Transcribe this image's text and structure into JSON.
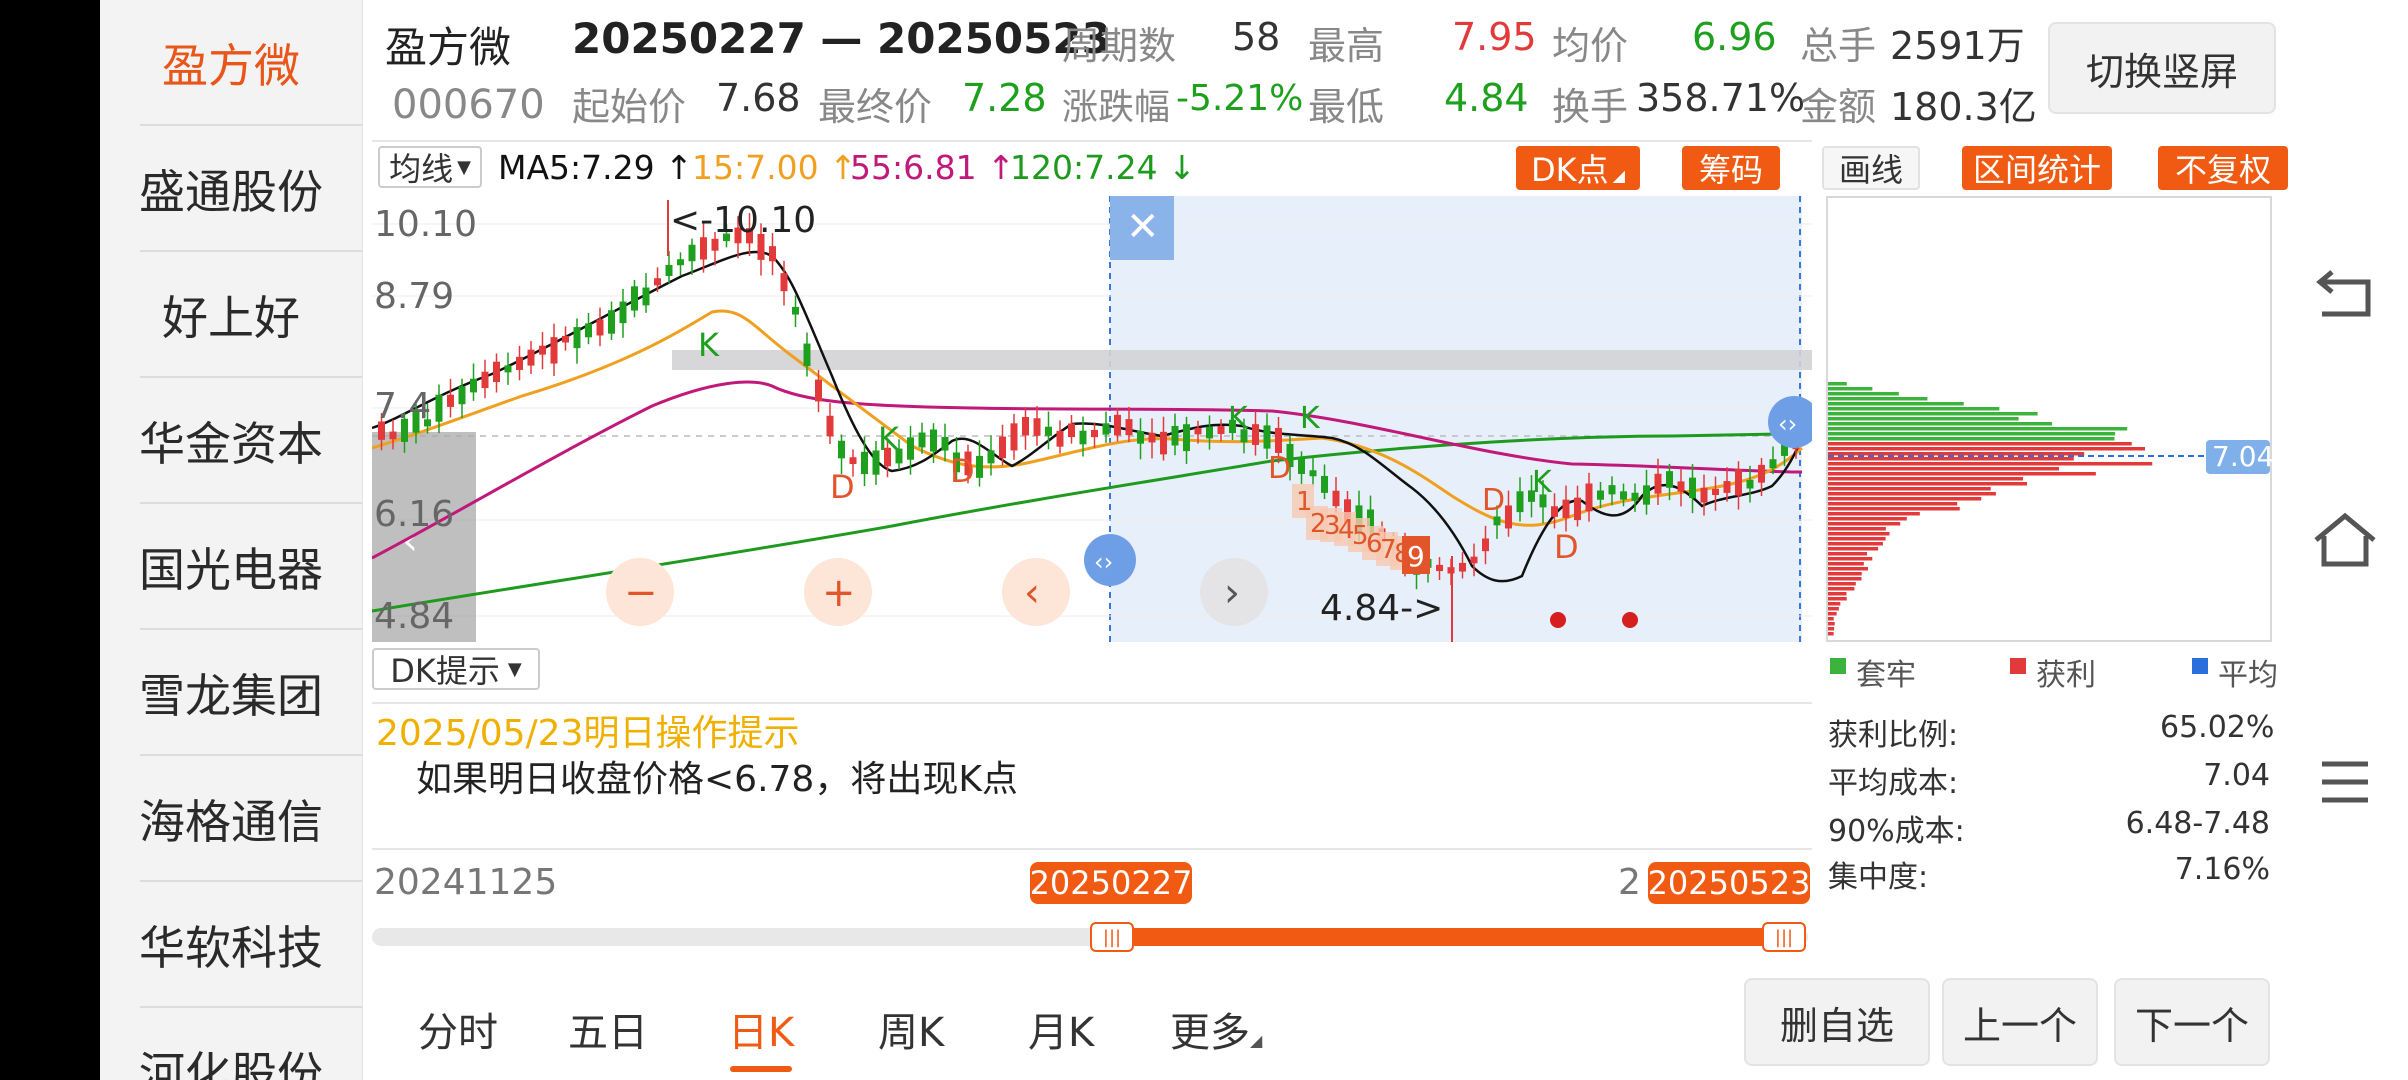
{
  "sidebar": {
    "items": [
      "盈方微",
      "盛通股份",
      "好上好",
      "华金资本",
      "国光电器",
      "雪龙集团",
      "海格通信",
      "华软科技",
      "河化股份"
    ]
  },
  "header": {
    "name": "盈方微",
    "code": "000670",
    "date_range": "20250227 — 20250523",
    "period_label": "周期数",
    "period_value": "58",
    "high_label": "最高",
    "high_value": "7.95",
    "avg_label": "均价",
    "avg_value": "6.96",
    "vol_label": "总手",
    "vol_value": "2591万",
    "start_label": "起始价",
    "start_value": "7.68",
    "end_label": "最终价",
    "end_value": "7.28",
    "chg_label": "涨跌幅",
    "chg_value": "-5.21%",
    "low_label": "最低",
    "low_value": "4.84",
    "turnover_label": "换手",
    "turnover_value": "358.71%",
    "amount_label": "金额",
    "amount_value": "180.3亿",
    "switch_button": "切换竖屏"
  },
  "indicator_bar": {
    "selector": "均线",
    "ma5": "MA5:7.29 ↑",
    "ma15": "15:7.00 ↑",
    "ma55": "55:6.81 ↑",
    "ma120": "120:7.24 ↓",
    "dk_button": "DK点",
    "chip_button": "筹码",
    "draw_button": "画线",
    "range_button": "区间统计",
    "adjust_button": "不复权"
  },
  "chart": {
    "y_labels": [
      "10.10",
      "8.79",
      "7.4",
      "6.16",
      "4.84"
    ],
    "max_marker": "<-10.10",
    "min_marker": "4.84->",
    "signals": [
      "K",
      "D",
      "K",
      "D",
      "K",
      "K",
      "D",
      "D",
      "K",
      "D"
    ],
    "seq_numbers": [
      "1",
      "2",
      "3",
      "4",
      "5",
      "6",
      "7",
      "8",
      "9"
    ],
    "colors": {
      "up": "#e23a3a",
      "down": "#1ea01e",
      "ma5": "#111111",
      "ma15": "#f0a020",
      "ma55": "#c0197a",
      "ma120": "#1e9a1e",
      "selection": "#e7effa",
      "accent": "#f15a12"
    }
  },
  "chip": {
    "price_tag": "7.04",
    "legend": {
      "trapped": "套牢",
      "profit": "获利",
      "avg": "平均"
    },
    "stats": [
      {
        "label": "获利比例:",
        "value": "65.02%"
      },
      {
        "label": "平均成本:",
        "value": "7.04"
      },
      {
        "label": "90%成本:",
        "value": "6.48-7.48"
      },
      {
        "label": "集中度:",
        "value": "7.16%"
      }
    ]
  },
  "tips": {
    "selector": "DK提示",
    "date_line": "2025/05/23明日操作提示",
    "message": "如果明日收盘价格<6.78，将出现K点"
  },
  "range_slider": {
    "start_date": "20241125",
    "end_cut": "2",
    "left_tag": "20250227",
    "right_tag": "20250523"
  },
  "tabs": [
    "分时",
    "五日",
    "日K",
    "周K",
    "月K",
    "更多"
  ],
  "active_tab": "日K",
  "actions": {
    "remove": "删自选",
    "prev": "上一个",
    "next": "下一个"
  }
}
